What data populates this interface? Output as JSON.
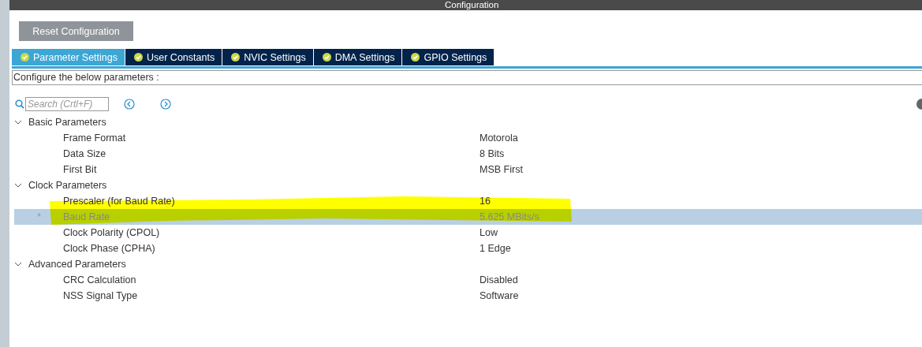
{
  "window": {
    "title": "Configuration"
  },
  "reset_button": "Reset Configuration",
  "tabs": [
    {
      "label": "Parameter Settings",
      "selected": true
    },
    {
      "label": "User Constants",
      "selected": false
    },
    {
      "label": "NVIC Settings",
      "selected": false
    },
    {
      "label": "DMA Settings",
      "selected": false
    },
    {
      "label": "GPIO Settings",
      "selected": false
    }
  ],
  "description": "Configure the below parameters :",
  "search": {
    "placeholder": "Search (Crtl+F)"
  },
  "tree": [
    {
      "label": "Basic Parameters",
      "expanded": true,
      "children": [
        {
          "name": "Frame Format",
          "value": "Motorola",
          "selected": false
        },
        {
          "name": "Data Size",
          "value": "8 Bits",
          "selected": false
        },
        {
          "name": "First Bit",
          "value": "MSB First",
          "selected": false
        }
      ]
    },
    {
      "label": "Clock Parameters",
      "expanded": true,
      "children": [
        {
          "name": "Prescaler (for Baud Rate)",
          "value": "16",
          "selected": false
        },
        {
          "name": "Baud Rate",
          "value": "5.625 MBits/s",
          "selected": true,
          "marker": "*"
        },
        {
          "name": "Clock Polarity (CPOL)",
          "value": "Low",
          "selected": false
        },
        {
          "name": "Clock Phase (CPHA)",
          "value": "1 Edge",
          "selected": false
        }
      ]
    },
    {
      "label": "Advanced Parameters",
      "expanded": true,
      "children": [
        {
          "name": "CRC Calculation",
          "value": "Disabled",
          "selected": false
        },
        {
          "name": "NSS Signal Type",
          "value": "Software",
          "selected": false
        }
      ]
    }
  ]
}
